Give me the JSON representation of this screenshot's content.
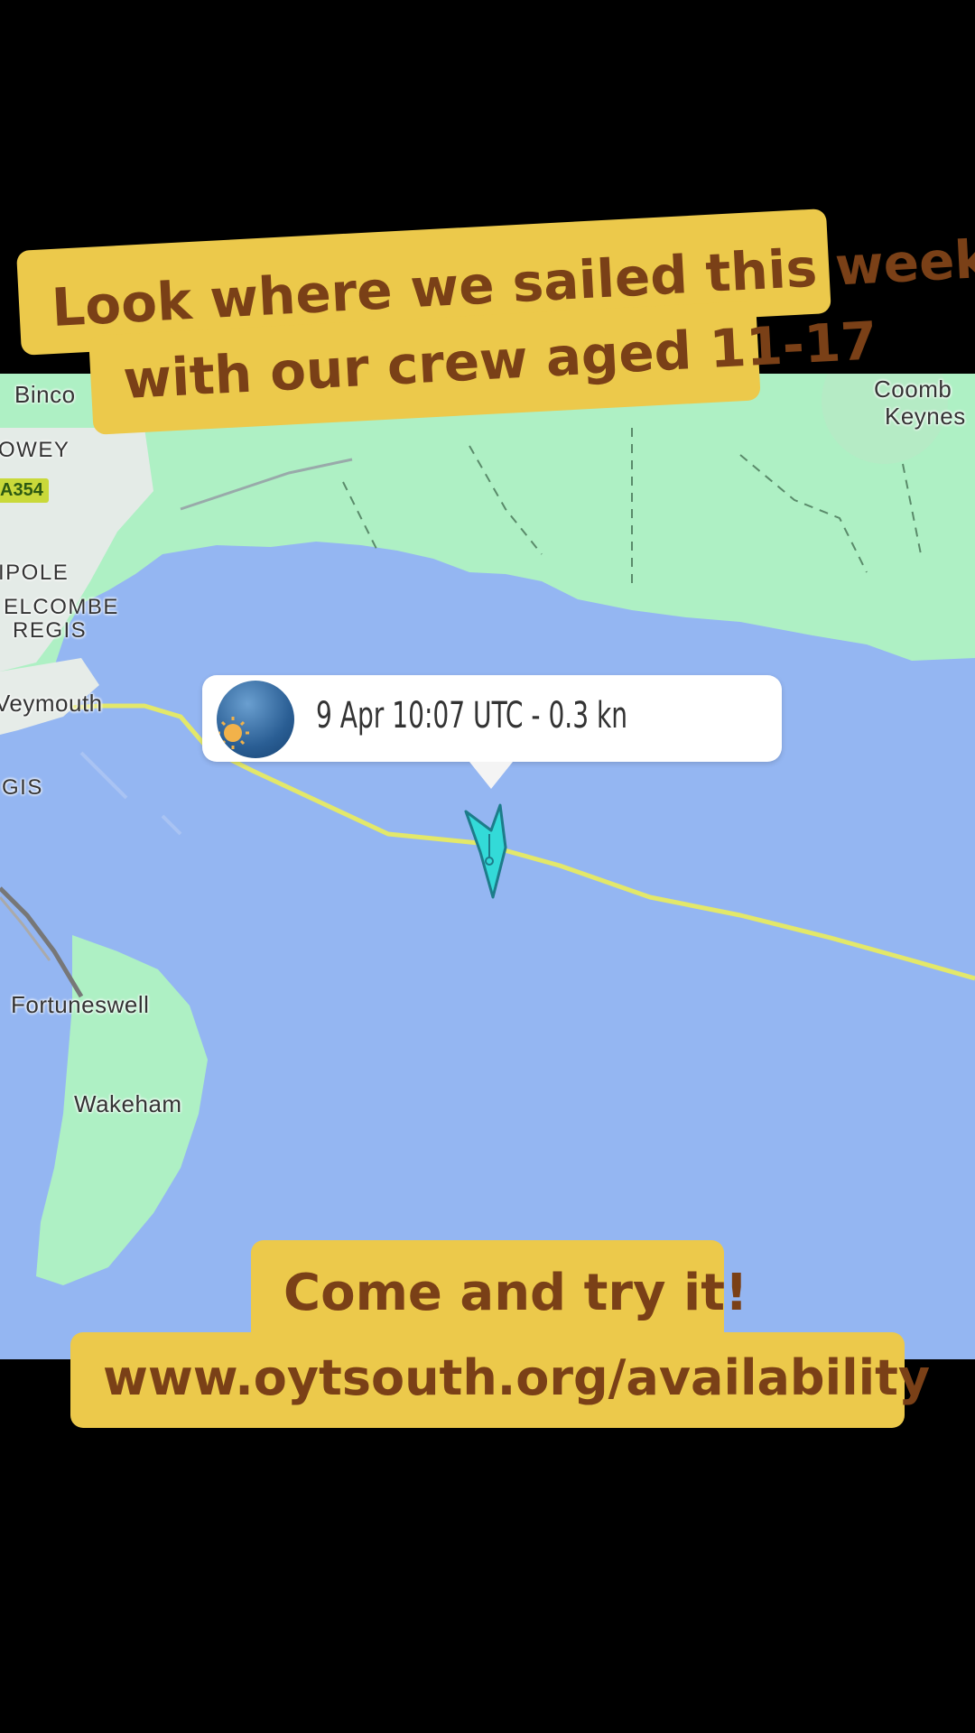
{
  "captions": {
    "top_line1": "Look where we sailed this week",
    "top_line2": "with our crew aged 11-17",
    "bottom_line1": "Come and try it!",
    "bottom_line2": "www.oytsouth.org/availability"
  },
  "map": {
    "places": {
      "binc": "Binco",
      "owey": "OWEY",
      "road": "A354",
      "ipole": "IPOLE",
      "elcombe": "ELCOMBE",
      "regis1": "REGIS",
      "weymouth": "Veymouth",
      "gis": "GIS",
      "fortuneswell": "Fortuneswell",
      "wakeham": "Wakeham",
      "coombe": "Coomb",
      "keynes": "Keynes"
    },
    "popup": {
      "text": "9 Apr 10:07 UTC - 0.3 kn",
      "icon": "weather-sun-icon"
    },
    "vessel_icon": "vessel-marker-icon"
  },
  "colors": {
    "sea": "#94b6f2",
    "land": "#aef0c4",
    "track": "#e3e86a",
    "vessel": "#33dad8",
    "caption_bg": "#ecc94b",
    "caption_text": "#7a4017"
  }
}
